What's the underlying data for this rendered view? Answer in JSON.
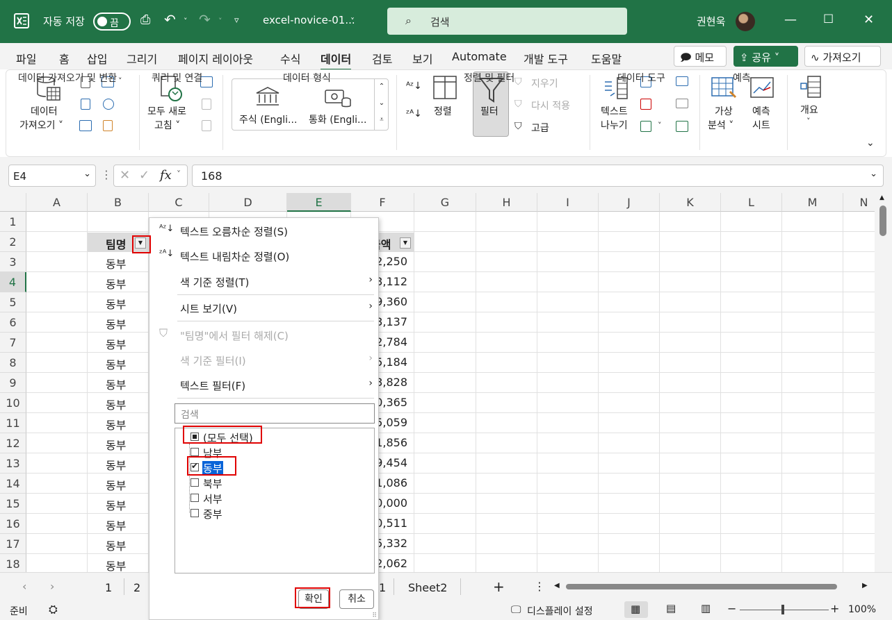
{
  "titlebar": {
    "autosave_label": "자동 저장",
    "autosave_state": "끔",
    "filename": "excel-novice-01...",
    "search_placeholder": "검색",
    "user_name": "권현욱"
  },
  "menu": {
    "items": [
      "파일",
      "홈",
      "삽입",
      "그리기",
      "페이지 레이아웃",
      "수식",
      "데이터",
      "검토",
      "보기",
      "Automate",
      "개발 도구",
      "도움말"
    ],
    "active": "데이터",
    "memo": "메모",
    "share": "공유",
    "get": "가져오기"
  },
  "ribbon": {
    "get_data_l1": "데이터",
    "get_data_l2": "가져오기 ˅",
    "refresh_l1": "모두 새로",
    "refresh_l2": "고침 ˅",
    "stock": "주식 (Engli...",
    "currency": "통화 (Engli...",
    "sort": "정렬",
    "filter": "필터",
    "clear": "지우기",
    "reapply": "다시 적용",
    "advanced": "고급",
    "text_split_l1": "텍스트",
    "text_split_l2": "나누기",
    "whatif_l1": "가상",
    "whatif_l2": "분석 ˅",
    "forecast_l1": "예측",
    "forecast_l2": "시트",
    "outline": "개요",
    "groups": {
      "get_transform": "데이터 가져오기 및 변환",
      "queries": "쿼리 및 연결",
      "data_types": "데이터 형식",
      "sort_filter": "정렬 및 필터",
      "data_tools": "데이터 도구",
      "forecast": "예측"
    }
  },
  "formula": {
    "name_box": "E4",
    "fx": "fx",
    "value": "168"
  },
  "grid": {
    "columns": [
      "A",
      "B",
      "C",
      "D",
      "E",
      "F",
      "G",
      "H",
      "I",
      "J",
      "K",
      "L",
      "M",
      "N"
    ],
    "selected_column": "E",
    "rows": [
      "1",
      "2",
      "3",
      "4",
      "5",
      "6",
      "7",
      "8",
      "9",
      "10",
      "11",
      "12",
      "13",
      "14",
      "15",
      "16",
      "17",
      "18"
    ],
    "selected_row": "4",
    "header_b": "팀명",
    "header_f": "금액",
    "b_values": [
      "동부",
      "동부",
      "동부",
      "동부",
      "동부",
      "동부",
      "동부",
      "동부",
      "동부",
      "동부",
      "동부",
      "동부",
      "동부",
      "동부",
      "동부",
      "동부"
    ],
    "f_values": [
      "2,250",
      "3,112",
      "9,360",
      "3,137",
      "2,784",
      "5,184",
      "3,828",
      "0,365",
      "5,059",
      "1,856",
      "9,454",
      "1,086",
      "0,000",
      "0,511",
      "5,332",
      "2,062"
    ]
  },
  "dropdown": {
    "sort_asc": "텍스트 오름차순 정렬(S)",
    "sort_desc": "텍스트 내림차순 정렬(O)",
    "sort_color": "색 기준 정렬(T)",
    "sheet_view": "시트 보기(V)",
    "clear_filter": "\"팀명\"에서 필터 해제(C)",
    "filter_color": "색 기준 필터(I)",
    "text_filter": "텍스트 필터(F)",
    "search_placeholder": "검색",
    "items": [
      {
        "label": "(모두 선택)",
        "state": "partial"
      },
      {
        "label": "남부",
        "state": "unchecked"
      },
      {
        "label": "동부",
        "state": "checked"
      },
      {
        "label": "북부",
        "state": "unchecked"
      },
      {
        "label": "서부",
        "state": "unchecked"
      },
      {
        "label": "중부",
        "state": "unchecked"
      }
    ],
    "ok": "확인",
    "cancel": "취소"
  },
  "tabs": {
    "t1": "1",
    "t2": "2",
    "t_hidden": "1",
    "sheet2": "Sheet2",
    "add": "+"
  },
  "status": {
    "ready": "준비",
    "display": "디스플레이 설정",
    "zoom": "100%"
  },
  "colors": {
    "accent": "#217346",
    "highlight": "#e00000",
    "selection": "#0a64d8"
  }
}
